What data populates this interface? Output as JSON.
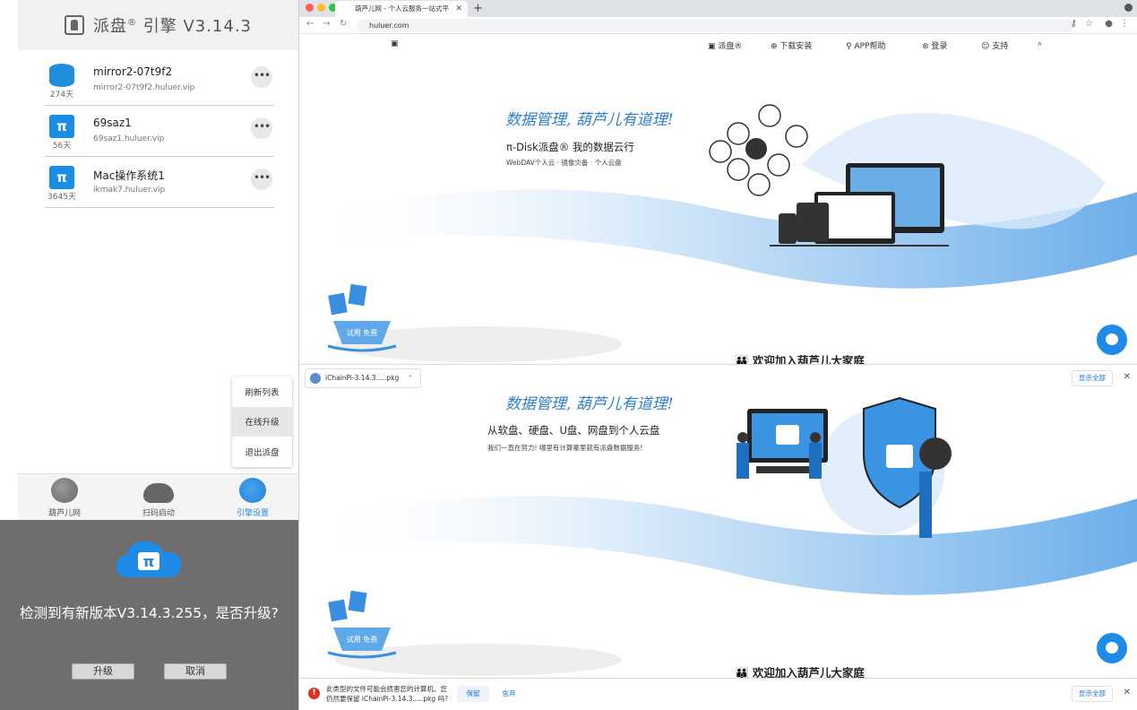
{
  "app": {
    "title": "派盘",
    "title_mark": "®",
    "title_suffix": "引擎 V3.14.3"
  },
  "servers": [
    {
      "name": "mirror2-07t9f2",
      "host": "mirror2-07t9f2.huluer.vip",
      "days": "274天",
      "icon": "database-icon"
    },
    {
      "name": "69saz1",
      "host": "69saz1.huluer.vip",
      "days": "56天",
      "icon": "pi-disk-icon"
    },
    {
      "name": "Mac操作系统1",
      "host": "ikmak7.huluer.vip",
      "days": "3645天",
      "icon": "pi-disk-icon"
    }
  ],
  "popup_menu": {
    "items": [
      "刷新列表",
      "在线升级",
      "退出派盘"
    ],
    "active_index": 1
  },
  "tabbar": {
    "tabs": [
      {
        "label": "葫芦儿网",
        "icon": "globe-icon"
      },
      {
        "label": "扫码启动",
        "icon": "cloud-scan-icon"
      },
      {
        "label": "引擎设置",
        "icon": "users-gear-icon"
      }
    ],
    "selected_index": 2
  },
  "update_dialog": {
    "message": "检测到有新版本V3.14.3.255，是否升级?",
    "confirm_label": "升级",
    "cancel_label": "取消"
  },
  "browser": {
    "tab_title": "葫芦儿网 - 个人云服务一站式平",
    "url": "huluer.com",
    "site_nav": [
      "派盘®",
      "下载安装",
      "APP帮助",
      "登录",
      "支持"
    ],
    "hero1": {
      "slogan": "数据管理, 葫芦儿有道理!",
      "title": "π-Disk派盘® 我的数据云行",
      "subtitle": "WebDAV个人云 · 镜像灾备 · 个人云盘",
      "join": "欢迎加入葫芦儿大家庭"
    },
    "hero2": {
      "slogan": "数据管理, 葫芦儿有道理!",
      "title": "从软盘、硬盘、U盘、网盘到个人云盘",
      "subtitle": "我们一直在努力! 哪里有计算哪里就有派盘数据服务!",
      "join": "欢迎加入葫芦儿大家庭"
    },
    "badge_text": "试用 免费",
    "downloads": {
      "file1": "iChainPi-3.14.3.....pkg",
      "warning_line1": "此类型的文件可能会损害您的计算机。您",
      "warning_line2": "仍然要保留 iChainPi-3.14.3.....pkg 吗?",
      "keep_label": "保留",
      "discard_label": "舍弃",
      "show_all_label": "显示全部"
    }
  },
  "colors": {
    "accent": "#1e8be6",
    "dialog_bg": "#6e6e6e",
    "warning": "#d93025"
  }
}
